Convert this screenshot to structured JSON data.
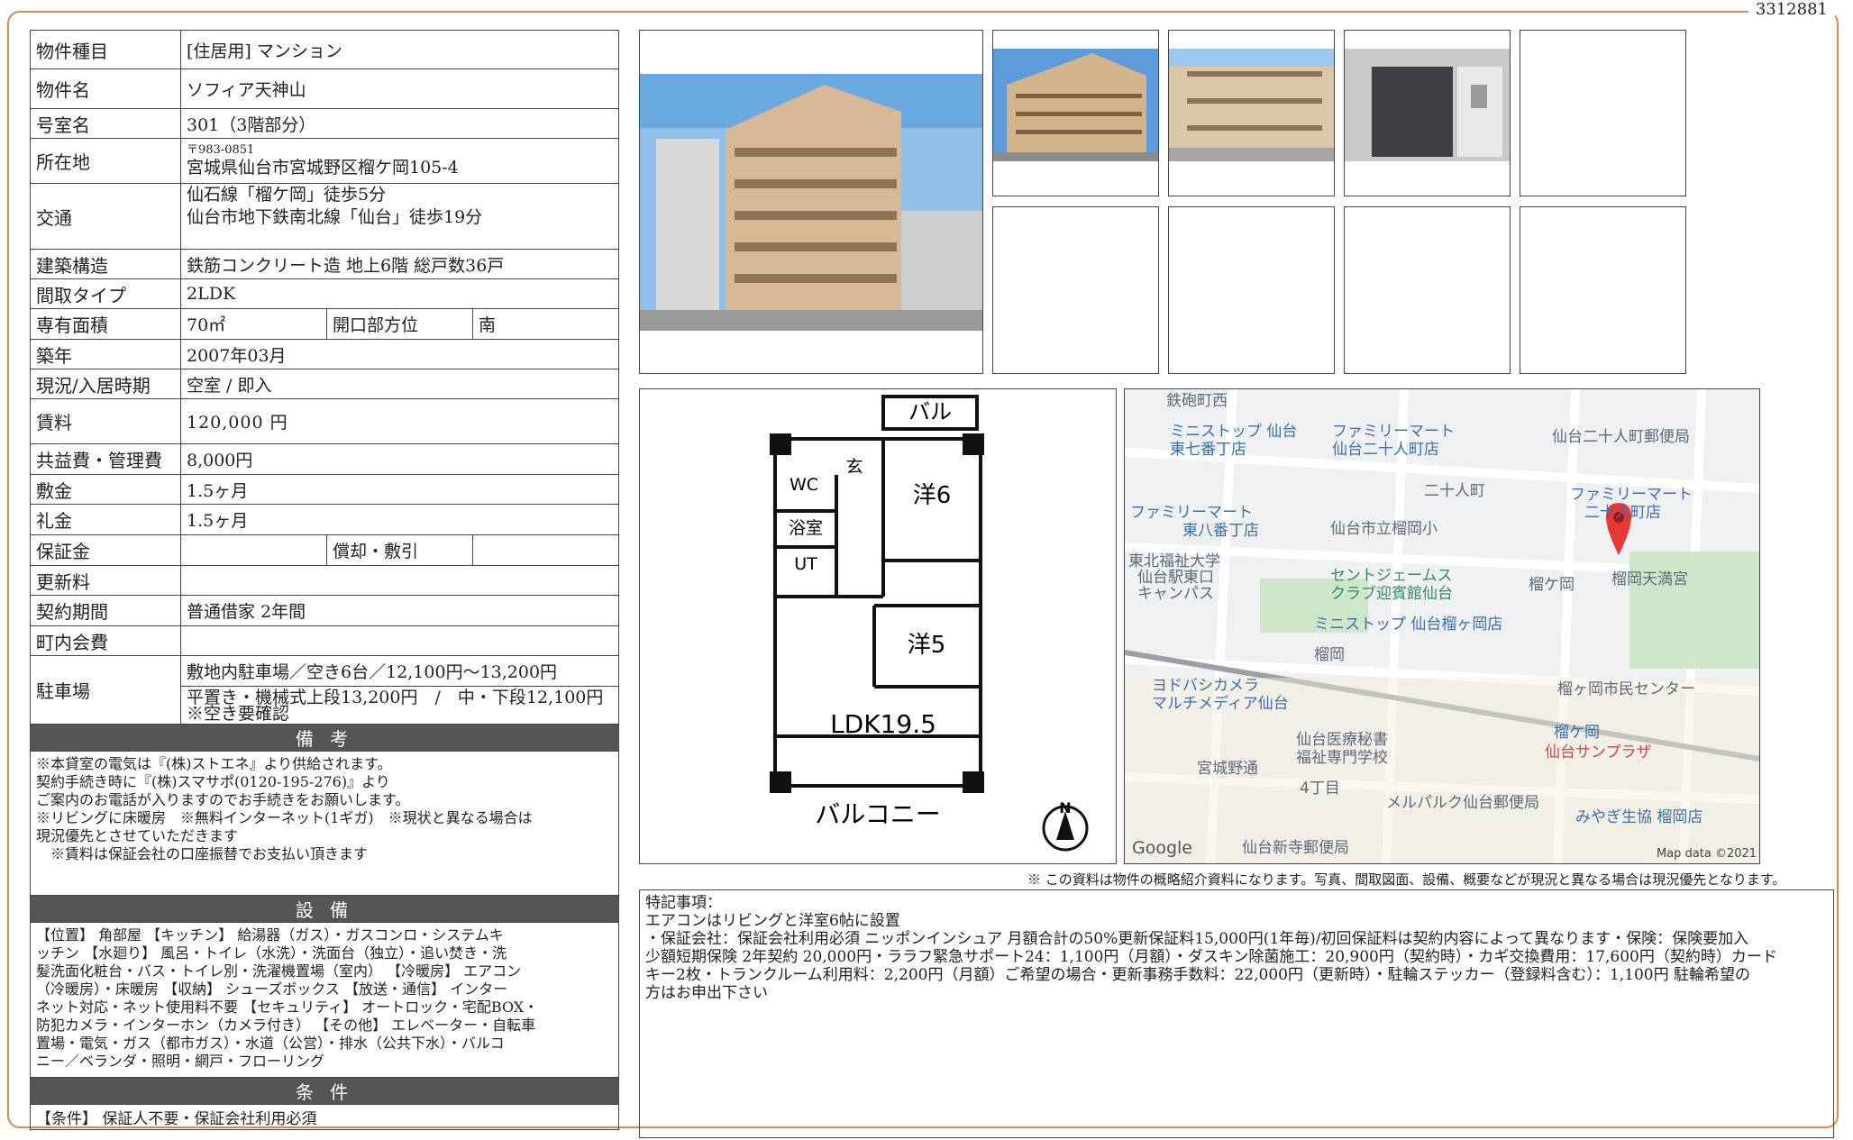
{
  "doc_id": "3312881",
  "property": {
    "type_label": "物件種目",
    "type_value": "[住居用]  マンション",
    "name_label": "物件名",
    "name_value": "ソフィア天神山",
    "room_label": "号室名",
    "room_value": "301（3階部分）",
    "address_label": "所在地",
    "postal": "〒983-0851",
    "address": "宮城県仙台市宮城野区榴ケ岡105-4",
    "access_label": "交通",
    "access_1": "仙石線「榴ケ岡」徒歩5分",
    "access_2": "仙台市地下鉄南北線「仙台」徒歩19分",
    "structure_label": "建築構造",
    "structure_value": "鉄筋コンクリート造 地上6階 総戸数36戸",
    "layout_label": "間取タイプ",
    "layout_value": "2LDK",
    "area_label": "専有面積",
    "area_value": "70㎡",
    "direction_label": "開口部方位",
    "direction_value": "南",
    "built_label": "築年",
    "built_value": "2007年03月",
    "status_label": "現況/入居時期",
    "status_value": "空室 / 即入",
    "rent_label": "賃料",
    "rent_value": "120,000 円",
    "fee_label": "共益費・管理費",
    "fee_value": "8,000円",
    "deposit_label": "敷金",
    "deposit_value": "1.5ヶ月",
    "key_label": "礼金",
    "key_value": "1.5ヶ月",
    "guarantee_label": "保証金",
    "guarantee_value": "",
    "amort_label": "償却・敷引",
    "amort_value": "",
    "renewal_label": "更新料",
    "renewal_value": "",
    "contract_label": "契約期間",
    "contract_value": "普通借家 2年間",
    "community_label": "町内会費",
    "community_value": "",
    "parking_label": "駐車場",
    "parking_1": "敷地内駐車場／空き6台／12,100円〜13,200円",
    "parking_2": "平置き・機械式上段13,200円　/　中・下段12,100円　※空き要確認"
  },
  "remarks_head": "備 考",
  "remarks_lines": [
    "※本貸室の電気は『(株)ストエネ』より供給されます。",
    "契約手続き時に『(株)スマサポ(0120-195-276)』より",
    "ご案内のお電話が入りますのでお手続きをお願いします。",
    "※リビングに床暖房　※無料インターネット(1ギガ)　※現状と異なる場合は",
    "現況優先とさせていただきます",
    "　※賃料は保証会社の口座振替でお支払い頂きます"
  ],
  "facilities_head": "設 備",
  "facilities_lines": [
    "【位置】 角部屋 【キッチン】 給湯器（ガス）・ガスコンロ・システムキ",
    "ッチン 【水廻り】 風呂・トイレ（水洗）・洗面台（独立）・追い焚き・洗",
    "髪洗面化粧台・バス・トイレ別・洗濯機置場（室内） 【冷暖房】 エアコン",
    "（冷暖房）・床暖房 【収納】 シューズボックス 【放送・通信】 インター",
    "ネット対応・ネット使用料不要 【セキュリティ】 オートロック・宅配BOX・",
    "防犯カメラ・インターホン（カメラ付き） 【その他】 エレベーター・自転車",
    "置場・電気・ガス（都市ガス）・水道（公営）・排水（公共下水）・バルコ",
    "ニー／ベランダ・照明・網戸・フローリング"
  ],
  "conditions_head": "条 件",
  "conditions_value": "【条件】 保証人不要・保証会社利用必須",
  "floorplan": {
    "balcony_top": "バル",
    "wc": "WC",
    "entrance": "玄",
    "bath": "浴室",
    "ut": "UT",
    "room6": "洋6",
    "room5": "洋5",
    "ldk": "LDK19.5",
    "balcony": "バルコニー",
    "north": "N"
  },
  "map_labels": [
    {
      "t": "鉄砲町西",
      "c": "gray"
    },
    {
      "t": "ミニストップ 仙台",
      "c": "blue"
    },
    {
      "t": "東七番丁店",
      "c": "blue"
    },
    {
      "t": "ファミリーマート",
      "c": "blue"
    },
    {
      "t": "仙台二十人町店",
      "c": "blue"
    },
    {
      "t": "仙台二十人町郵便局",
      "c": "gray"
    },
    {
      "t": "二十人町",
      "c": "gray"
    },
    {
      "t": "ファミリーマート",
      "c": "blue"
    },
    {
      "t": "二十人町店",
      "c": "blue"
    },
    {
      "t": "ファミリーマート",
      "c": "blue"
    },
    {
      "t": "東八番丁店",
      "c": "blue"
    },
    {
      "t": "仙台市立榴岡小",
      "c": "gray"
    },
    {
      "t": "東北福祉大学",
      "c": "gray"
    },
    {
      "t": "仙台駅東口",
      "c": "gray"
    },
    {
      "t": "キャンパス",
      "c": "gray"
    },
    {
      "t": "セントジェームス",
      "c": "green"
    },
    {
      "t": "クラブ迎賓館仙台",
      "c": "green"
    },
    {
      "t": "榴ケ岡",
      "c": "gray"
    },
    {
      "t": "榴岡天満宮",
      "c": "gray"
    },
    {
      "t": "ミニストップ 仙台榴ヶ岡店",
      "c": "blue"
    },
    {
      "t": "榴岡",
      "c": "gray"
    },
    {
      "t": "ヨドバシカメラ",
      "c": "blue"
    },
    {
      "t": "マルチメディア仙台",
      "c": "blue"
    },
    {
      "t": "榴ヶ岡市民センター",
      "c": "gray"
    },
    {
      "t": "榴ケ岡",
      "c": "blue"
    },
    {
      "t": "仙台サンプラザ",
      "c": "red"
    },
    {
      "t": "仙台医療秘書",
      "c": "gray"
    },
    {
      "t": "福祉専門学校",
      "c": "gray"
    },
    {
      "t": "宮城野通",
      "c": "gray"
    },
    {
      "t": "4丁目",
      "c": "gray"
    },
    {
      "t": "メルパルク仙台郵便局",
      "c": "gray"
    },
    {
      "t": "みやぎ生協 榴岡店",
      "c": "blue"
    },
    {
      "t": "Google",
      "c": "gray"
    },
    {
      "t": "仙台新寺郵便局",
      "c": "gray"
    },
    {
      "t": "Map data ©2021",
      "c": "gray"
    }
  ],
  "disclaimer": "※ この資料は物件の概略紹介資料になります。写真、間取図面、設備、概要などが現況と異なる場合は現況優先となります。",
  "special_lines": [
    "特記事項：",
    "エアコンはリビングと洋室6帖に設置",
    "・保証会社：保証会社利用必須 ニッポンインシュア 月額合計の50%更新保証料15,000円(1年毎)/初回保証料は契約内容によって異なります・保険：保険要加入",
    "少額短期保険 2年契約 20,000円・ララフ緊急サポート24：1,100円（月額）・ダスキン除菌施工：20,900円（契約時）・カギ交換費用：17,600円（契約時）カード",
    "キー2枚・トランクルーム利用料：2,200円（月額）ご希望の場合・更新事務手数料：22,000円（更新時）・駐輪ステッカー（登録料含む）：1,100円 駐輪希望の",
    "方はお申出下さい"
  ]
}
